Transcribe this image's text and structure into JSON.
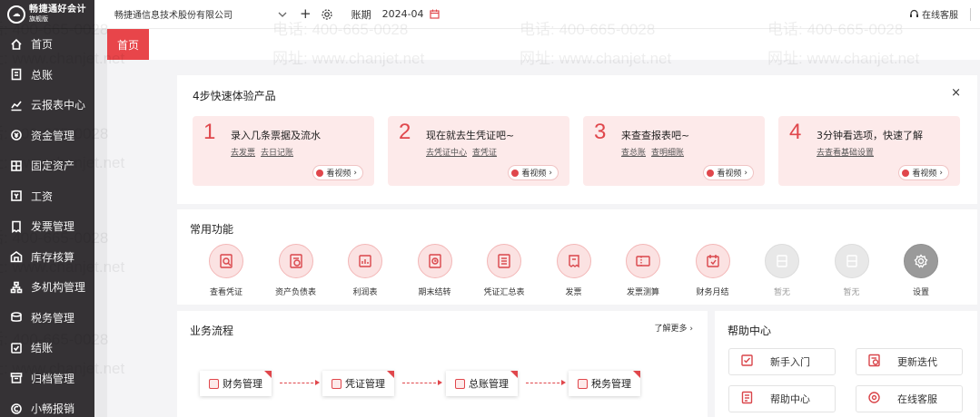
{
  "app": {
    "logo_name": "畅捷通好会计",
    "logo_sub": "旗舰版"
  },
  "sidebar": {
    "items": [
      {
        "label": "首页",
        "icon": "home-icon"
      },
      {
        "label": "总账",
        "icon": "ledger-icon"
      },
      {
        "label": "云报表中心",
        "icon": "chart-icon"
      },
      {
        "label": "资金管理",
        "icon": "money-icon"
      },
      {
        "label": "固定资产",
        "icon": "asset-icon"
      },
      {
        "label": "工资",
        "icon": "salary-icon"
      },
      {
        "label": "发票管理",
        "icon": "invoice-icon"
      },
      {
        "label": "库存核算",
        "icon": "warehouse-icon"
      },
      {
        "label": "多机构管理",
        "icon": "org-icon"
      },
      {
        "label": "税务管理",
        "icon": "tax-icon"
      },
      {
        "label": "结账",
        "icon": "close-account-icon"
      },
      {
        "label": "归档管理",
        "icon": "archive-icon"
      },
      {
        "label": "小畅报销",
        "icon": "reimburse-icon"
      }
    ]
  },
  "topbar": {
    "company": "畅捷通信息技术股份有限公司",
    "add": "+",
    "period_label": "账期",
    "period_value": "2024-04",
    "service": "在线客服"
  },
  "tabs": {
    "home": "首页"
  },
  "quick": {
    "title": "4步快速体验产品",
    "close": "×",
    "video_label": "看视频",
    "steps": [
      {
        "num": "1",
        "title": "录入几条票据及流水",
        "links": [
          "去发票",
          "去日记账"
        ]
      },
      {
        "num": "2",
        "title": "现在就去生凭证吧~",
        "links": [
          "去凭证中心",
          "查凭证"
        ]
      },
      {
        "num": "3",
        "title": "来查查报表吧~",
        "links": [
          "查总账",
          "查明细账"
        ]
      },
      {
        "num": "4",
        "title": "3分钟看选项，快速了解",
        "links": [
          "去查看基础设置"
        ]
      }
    ]
  },
  "common": {
    "title": "常用功能",
    "items": [
      {
        "label": "查看凭证",
        "state": "on"
      },
      {
        "label": "资产负债表",
        "state": "on"
      },
      {
        "label": "利润表",
        "state": "on"
      },
      {
        "label": "期末结转",
        "state": "on"
      },
      {
        "label": "凭证汇总表",
        "state": "on"
      },
      {
        "label": "发票",
        "state": "on"
      },
      {
        "label": "发票测算",
        "state": "on"
      },
      {
        "label": "财务月结",
        "state": "on"
      },
      {
        "label": "暂无",
        "state": "off"
      },
      {
        "label": "暂无",
        "state": "off"
      },
      {
        "label": "设置",
        "state": "dark"
      }
    ]
  },
  "flow": {
    "title": "业务流程",
    "more": "了解更多",
    "cards": [
      "财务管理",
      "凭证管理",
      "总账管理",
      "税务管理"
    ]
  },
  "help": {
    "title": "帮助中心",
    "buttons": [
      "新手入门",
      "更新迭代",
      "帮助中心",
      "在线客服"
    ]
  },
  "watermark": {
    "phone": "电话: 400-665-0028",
    "site": "网址: www.chanjet.net"
  },
  "colors": {
    "sidebar": "#353235",
    "accent": "#e8454a",
    "step_bg": "#fdeaea"
  }
}
